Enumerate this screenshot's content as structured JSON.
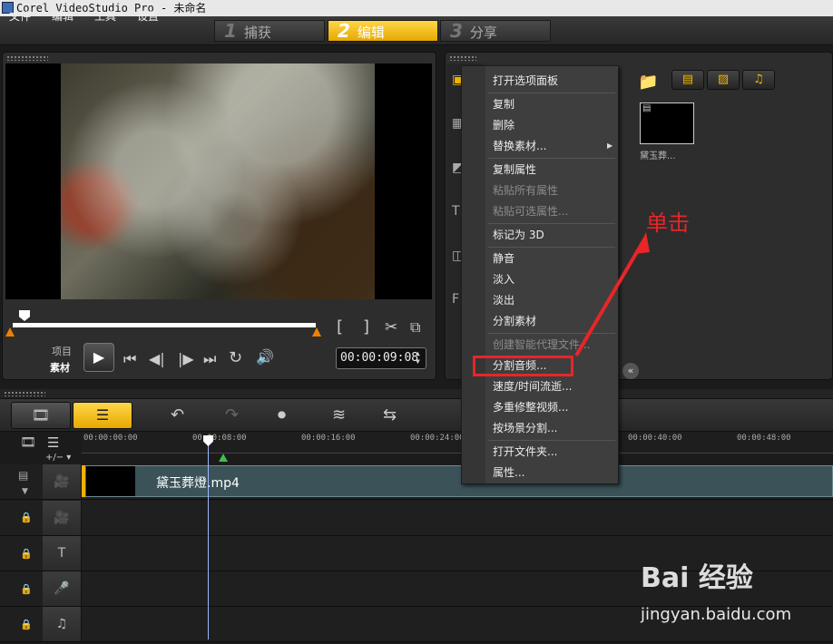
{
  "window": {
    "title": "Corel VideoStudio Pro - 未命名"
  },
  "menu": {
    "items": [
      "文件",
      "编辑",
      "工具",
      "设置"
    ]
  },
  "modes": [
    {
      "num": "1",
      "label": "捕获"
    },
    {
      "num": "2",
      "label": "编辑"
    },
    {
      "num": "3",
      "label": "分享"
    }
  ],
  "preview": {
    "labels": {
      "project": "项目",
      "clip": "素材"
    },
    "timecode": "00:00:09:08",
    "controls": {
      "bracket_in": "[",
      "bracket_out": "]"
    }
  },
  "library": {
    "thumb_label": "黛玉葬...",
    "collapse": "«"
  },
  "context_menu": {
    "items": [
      {
        "label": "打开选项面板",
        "disabled": false
      },
      {
        "label": "复制",
        "disabled": false
      },
      {
        "label": "删除",
        "disabled": false
      },
      {
        "label": "替换素材...",
        "disabled": false
      },
      {
        "label": "复制属性",
        "disabled": false
      },
      {
        "label": "粘贴所有属性",
        "disabled": true
      },
      {
        "label": "粘贴可选属性...",
        "disabled": true
      },
      {
        "label": "标记为 3D",
        "disabled": false
      },
      {
        "label": "静音",
        "disabled": false
      },
      {
        "label": "淡入",
        "disabled": false
      },
      {
        "label": "淡出",
        "disabled": false
      },
      {
        "label": "分割素材",
        "disabled": false
      },
      {
        "label": "创建智能代理文件...",
        "disabled": true
      },
      {
        "label": "分割音频...",
        "disabled": false
      },
      {
        "label": "速度/时间流逝...",
        "disabled": false
      },
      {
        "label": "多重修整视频...",
        "disabled": false
      },
      {
        "label": "按场景分割...",
        "disabled": false
      },
      {
        "label": "打开文件夹...",
        "disabled": false
      },
      {
        "label": "属性...",
        "disabled": false
      }
    ]
  },
  "annotation": {
    "text": "单击"
  },
  "timeline": {
    "ruler": [
      "00:00:00:00",
      "00:00:08:00",
      "00:00:16:00",
      "00:00:24:00",
      "00:00:40:00",
      "00:00:48:00"
    ],
    "zoom": "+/− ▾",
    "clip_name": "黛玉葬燈.mp4"
  },
  "watermark": {
    "brand": "Bai  经验",
    "url": "jingyan.baidu.com"
  },
  "colors": {
    "accent": "#f2b400",
    "highlight": "#e82528"
  }
}
